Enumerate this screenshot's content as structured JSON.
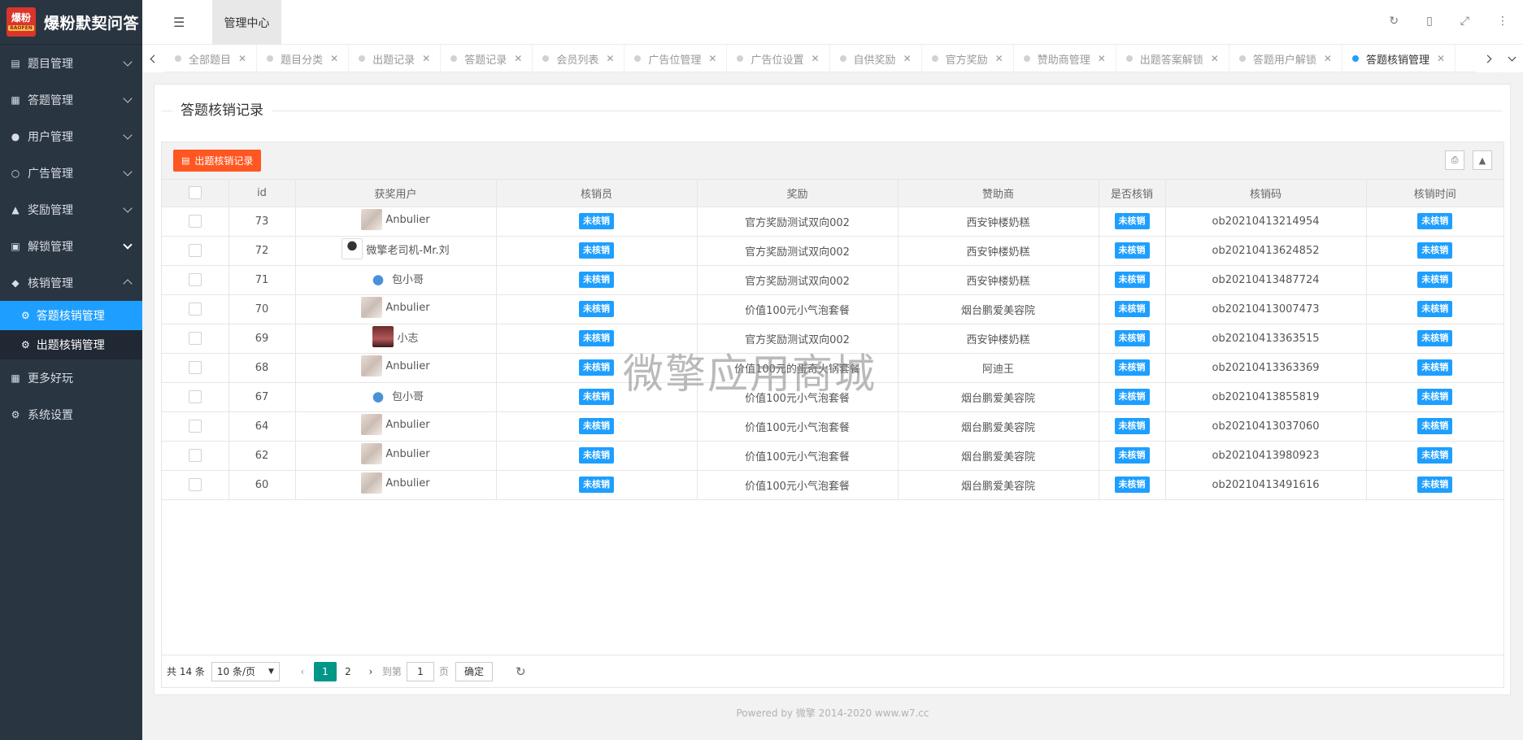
{
  "app": {
    "logo_top": "爆粉",
    "logo_sub": "BAOFEN",
    "name": "爆粉默契问答"
  },
  "sidebar": {
    "items": [
      {
        "label": "题目管理",
        "icon": "book-icon"
      },
      {
        "label": "答题管理",
        "icon": "calendar-icon"
      },
      {
        "label": "用户管理",
        "icon": "users-icon"
      },
      {
        "label": "广告管理",
        "icon": "circle-icon"
      },
      {
        "label": "奖励管理",
        "icon": "gift-icon"
      },
      {
        "label": "解锁管理",
        "icon": "cart-icon"
      },
      {
        "label": "核销管理",
        "icon": "tag-icon"
      }
    ],
    "sub_items": [
      {
        "label": "答题核销管理"
      },
      {
        "label": "出题核销管理"
      }
    ],
    "bottom_items": [
      {
        "label": "更多好玩",
        "icon": "grid-icon"
      },
      {
        "label": "系统设置",
        "icon": "gear-icon"
      }
    ]
  },
  "header": {
    "tab_label": "管理中心"
  },
  "tabs": [
    "全部题目",
    "题目分类",
    "出题记录",
    "答题记录",
    "会员列表",
    "广告位管理",
    "广告位设置",
    "自供奖励",
    "官方奖励",
    "赞助商管理",
    "出题答案解锁",
    "答题用户解锁",
    "答题核销管理"
  ],
  "panel": {
    "title": "答题核销记录",
    "export_label": "出题核销记录"
  },
  "table": {
    "columns": [
      "id",
      "获奖用户",
      "核销员",
      "奖励",
      "赞助商",
      "是否核销",
      "核销码",
      "核销时间"
    ],
    "rows": [
      {
        "id": "73",
        "user": "Anbulier",
        "av": "a",
        "clerk": "未核销",
        "reward": "官方奖励测试双向002",
        "sponsor": "西安钟楼奶糕",
        "done": "未核销",
        "code": "ob20210413214954",
        "time": "未核销"
      },
      {
        "id": "72",
        "user": "微擎老司机-Mr.刘",
        "av": "b",
        "clerk": "未核销",
        "reward": "官方奖励测试双向002",
        "sponsor": "西安钟楼奶糕",
        "done": "未核销",
        "code": "ob20210413624852",
        "time": "未核销"
      },
      {
        "id": "71",
        "user": "包小哥",
        "av": "c",
        "clerk": "未核销",
        "reward": "官方奖励测试双向002",
        "sponsor": "西安钟楼奶糕",
        "done": "未核销",
        "code": "ob20210413487724",
        "time": "未核销"
      },
      {
        "id": "70",
        "user": "Anbulier",
        "av": "a",
        "clerk": "未核销",
        "reward": "价值100元小气泡套餐",
        "sponsor": "烟台鹏爱美容院",
        "done": "未核销",
        "code": "ob20210413007473",
        "time": "未核销"
      },
      {
        "id": "69",
        "user": "小志",
        "av": "d",
        "clerk": "未核销",
        "reward": "官方奖励测试双向002",
        "sponsor": "西安钟楼奶糕",
        "done": "未核销",
        "code": "ob20210413363515",
        "time": "未核销"
      },
      {
        "id": "68",
        "user": "Anbulier",
        "av": "a",
        "clerk": "未核销",
        "reward": "价值100元的蛋奇火锅套餐",
        "sponsor": "阿迪王",
        "done": "未核销",
        "code": "ob20210413363369",
        "time": "未核销"
      },
      {
        "id": "67",
        "user": "包小哥",
        "av": "c",
        "clerk": "未核销",
        "reward": "价值100元小气泡套餐",
        "sponsor": "烟台鹏爱美容院",
        "done": "未核销",
        "code": "ob20210413855819",
        "time": "未核销"
      },
      {
        "id": "64",
        "user": "Anbulier",
        "av": "a",
        "clerk": "未核销",
        "reward": "价值100元小气泡套餐",
        "sponsor": "烟台鹏爱美容院",
        "done": "未核销",
        "code": "ob20210413037060",
        "time": "未核销"
      },
      {
        "id": "62",
        "user": "Anbulier",
        "av": "a",
        "clerk": "未核销",
        "reward": "价值100元小气泡套餐",
        "sponsor": "烟台鹏爱美容院",
        "done": "未核销",
        "code": "ob20210413980923",
        "time": "未核销"
      },
      {
        "id": "60",
        "user": "Anbulier",
        "av": "a",
        "clerk": "未核销",
        "reward": "价值100元小气泡套餐",
        "sponsor": "烟台鹏爱美容院",
        "done": "未核销",
        "code": "ob20210413491616",
        "time": "未核销"
      }
    ]
  },
  "pager": {
    "total": "共 14 条",
    "page_size": "10 条/页",
    "page1": "1",
    "page2": "2",
    "goto_label": "到第",
    "goto_value": "1",
    "page_unit": "页",
    "confirm": "确定"
  },
  "watermark": "微擎应用商城",
  "footer": "Powered by 微擎 2014-2020 www.w7.cc",
  "colors": {
    "sidebar": "#2a3542",
    "active": "#1e9fff",
    "export": "#ff5722",
    "page_current": "#009688"
  }
}
